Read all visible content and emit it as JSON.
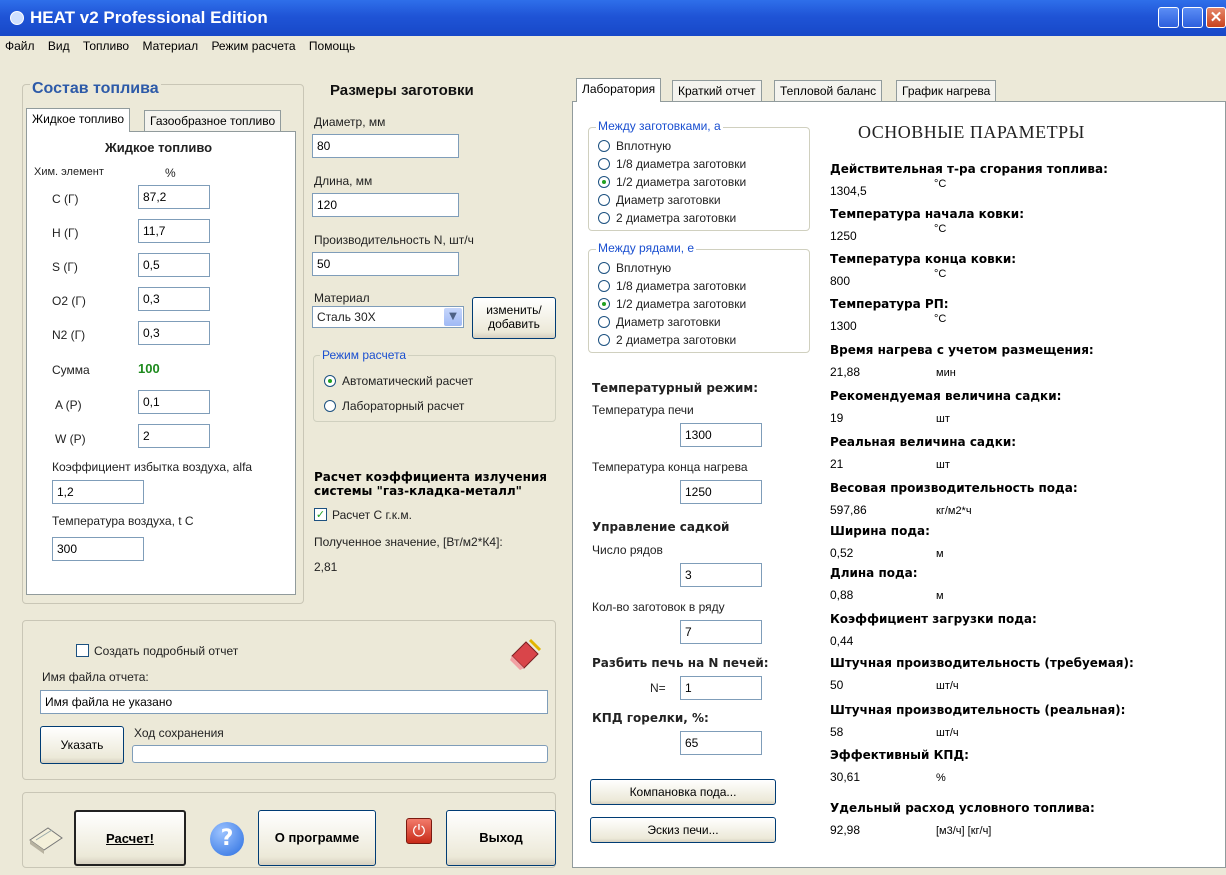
{
  "window": {
    "title": "HEAT v2 Professional Edition"
  },
  "menu": [
    "Файл",
    "Вид",
    "Топливо",
    "Материал",
    "Режим расчета",
    "Помощь"
  ],
  "fuel": {
    "title": "Состав топлива",
    "tabs": [
      "Жидкое топливо",
      "Газообразное топливо"
    ],
    "heading": "Жидкое топливо",
    "col_element": "Хим. элемент",
    "col_percent": "%",
    "rows": [
      {
        "label": "C (Г)",
        "value": "87,2"
      },
      {
        "label": "H (Г)",
        "value": "11,7"
      },
      {
        "label": "S (Г)",
        "value": "0,5"
      },
      {
        "label": "O2 (Г)",
        "value": "0,3"
      },
      {
        "label": "N2 (Г)",
        "value": "0,3"
      }
    ],
    "sum_label": "Сумма",
    "sum_value": "100",
    "ash_label": "A (P)",
    "ash_value": "0,1",
    "water_label": "W (P)",
    "water_value": "2",
    "alfa_label": "Коэффициент избытка воздуха, alfa",
    "alfa_value": "1,2",
    "air_temp_label": "Температура воздуха, t C",
    "air_temp_value": "300"
  },
  "blank": {
    "title": "Размеры заготовки",
    "diameter_label": "Диаметр, мм",
    "diameter_value": "80",
    "length_label": "Длина, мм",
    "length_value": "120",
    "prod_label": "Производительность N, шт/ч",
    "prod_value": "50",
    "material_label": "Материал",
    "material_value": "Сталь 30Х",
    "change_button": "изменить/ добавить",
    "mode_legend": "Режим расчета",
    "mode_auto": "Автоматический расчет",
    "mode_lab": "Лабораторный расчет",
    "emiss_title": "Расчет коэффициента излучения системы \"газ-кладка-металл\"",
    "emiss_check": "Расчет C г.к.м.",
    "emiss_result_label": "Полученное значение, [Вт/м2*К4]:",
    "emiss_result_value": "2,81"
  },
  "report": {
    "create_check": "Создать подробный отчет",
    "filename_label": "Имя файла отчета:",
    "filename_value": "Имя файла не указано",
    "browse_button": "Указать",
    "progress_label": "Ход сохранения",
    "progress": 0
  },
  "bottom": {
    "calc_button": "Расчет!",
    "about_button": "О программе",
    "exit_button": "Выход"
  },
  "right": {
    "tabs": [
      "Лаборатория",
      "Краткий отчет",
      "Тепловой баланс",
      "График нагрева"
    ],
    "between_blanks_legend": "Между заготовками, a",
    "between_rows_legend": "Между рядами, e",
    "spacing_options": [
      "Вплотную",
      "1/8 диаметра заготовки",
      "1/2 диаметра заготовки",
      "Диаметр заготовки",
      "2 диаметра заготовки"
    ],
    "temp_mode_title": "Температурный режим:",
    "furnace_temp_label": "Температура печи",
    "furnace_temp_value": "1300",
    "end_heat_temp_label": "Температура конца нагрева",
    "end_heat_temp_value": "1250",
    "load_title": "Управление садкой",
    "rows_label": "Число рядов",
    "rows_value": "3",
    "per_row_label": "Кол-во заготовок в ряду",
    "per_row_value": "7",
    "split_title": "Разбить печь на N печей:",
    "split_label": "N=",
    "split_value": "1",
    "burner_title": "КПД горелки, %:",
    "burner_value": "65",
    "layout_button": "Компановка пода...",
    "sketch_button": "Эскиз печи...",
    "params_title": "ОСНОВНЫЕ ПАРАМЕТРЫ",
    "params": [
      {
        "label": "Действительная т-ра сгорания топлива:",
        "value": "1304,5",
        "unit": "°С"
      },
      {
        "label": "Температура начала ковки:",
        "value": "1250",
        "unit": "°С"
      },
      {
        "label": "Температура конца ковки:",
        "value": "800",
        "unit": "°С"
      },
      {
        "label": "Температура РП:",
        "value": "1300",
        "unit": "°С"
      },
      {
        "label": "Время нагрева с учетом размещения:",
        "value": "21,88",
        "unit": "мин"
      },
      {
        "label": "Рекомендуемая величина садки:",
        "value": "19",
        "unit": "шт"
      },
      {
        "label": "Реальная величина садки:",
        "value": "21",
        "unit": "шт"
      },
      {
        "label": "Весовая производительность пода:",
        "value": "597,86",
        "unit": "кг/м2*ч"
      },
      {
        "label": "Ширина пода:",
        "value": "0,52",
        "unit": "м"
      },
      {
        "label": "Длина пода:",
        "value": "0,88",
        "unit": "м"
      },
      {
        "label": "Коэффициент загрузки пода:",
        "value": "0,44",
        "unit": ""
      },
      {
        "label": "Штучная производительность (требуемая):",
        "value": "50",
        "unit": "шт/ч"
      },
      {
        "label": "Штучная производительность (реальная):",
        "value": "58",
        "unit": "шт/ч"
      },
      {
        "label": "Эффективный КПД:",
        "value": "30,61",
        "unit": "%"
      },
      {
        "label": "Удельный расход условного топлива:",
        "value": "92,98",
        "unit": "[м3/ч] [кг/ч]"
      }
    ]
  }
}
